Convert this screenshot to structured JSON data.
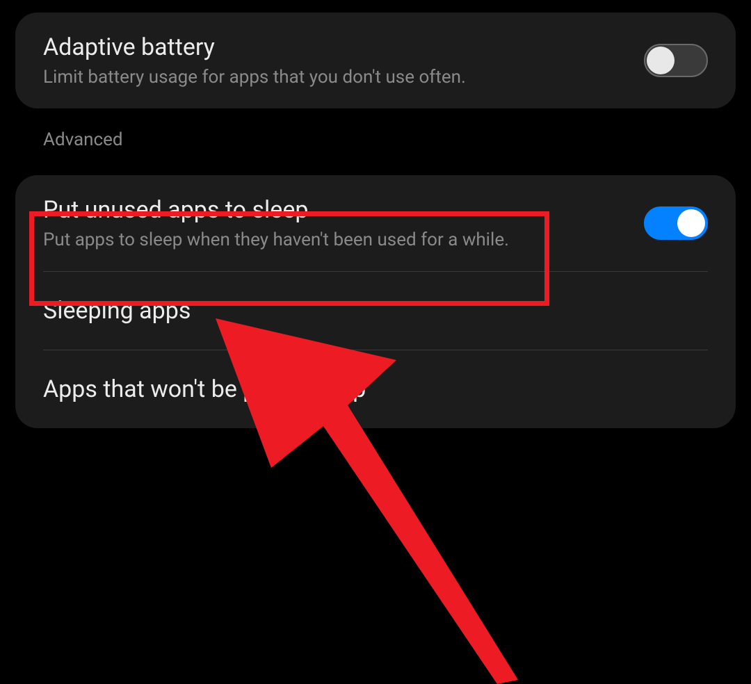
{
  "card1": {
    "adaptive_battery": {
      "title": "Adaptive battery",
      "desc": "Limit battery usage for apps that you don't use often."
    }
  },
  "section_header": "Advanced",
  "card2": {
    "put_unused_sleep": {
      "title": "Put unused apps to sleep",
      "desc": "Put apps to sleep when they haven't been used for a while."
    },
    "sleeping_apps": {
      "title": "Sleeping apps"
    },
    "apps_no_sleep": {
      "title": "Apps that won't be put to sleep"
    }
  }
}
